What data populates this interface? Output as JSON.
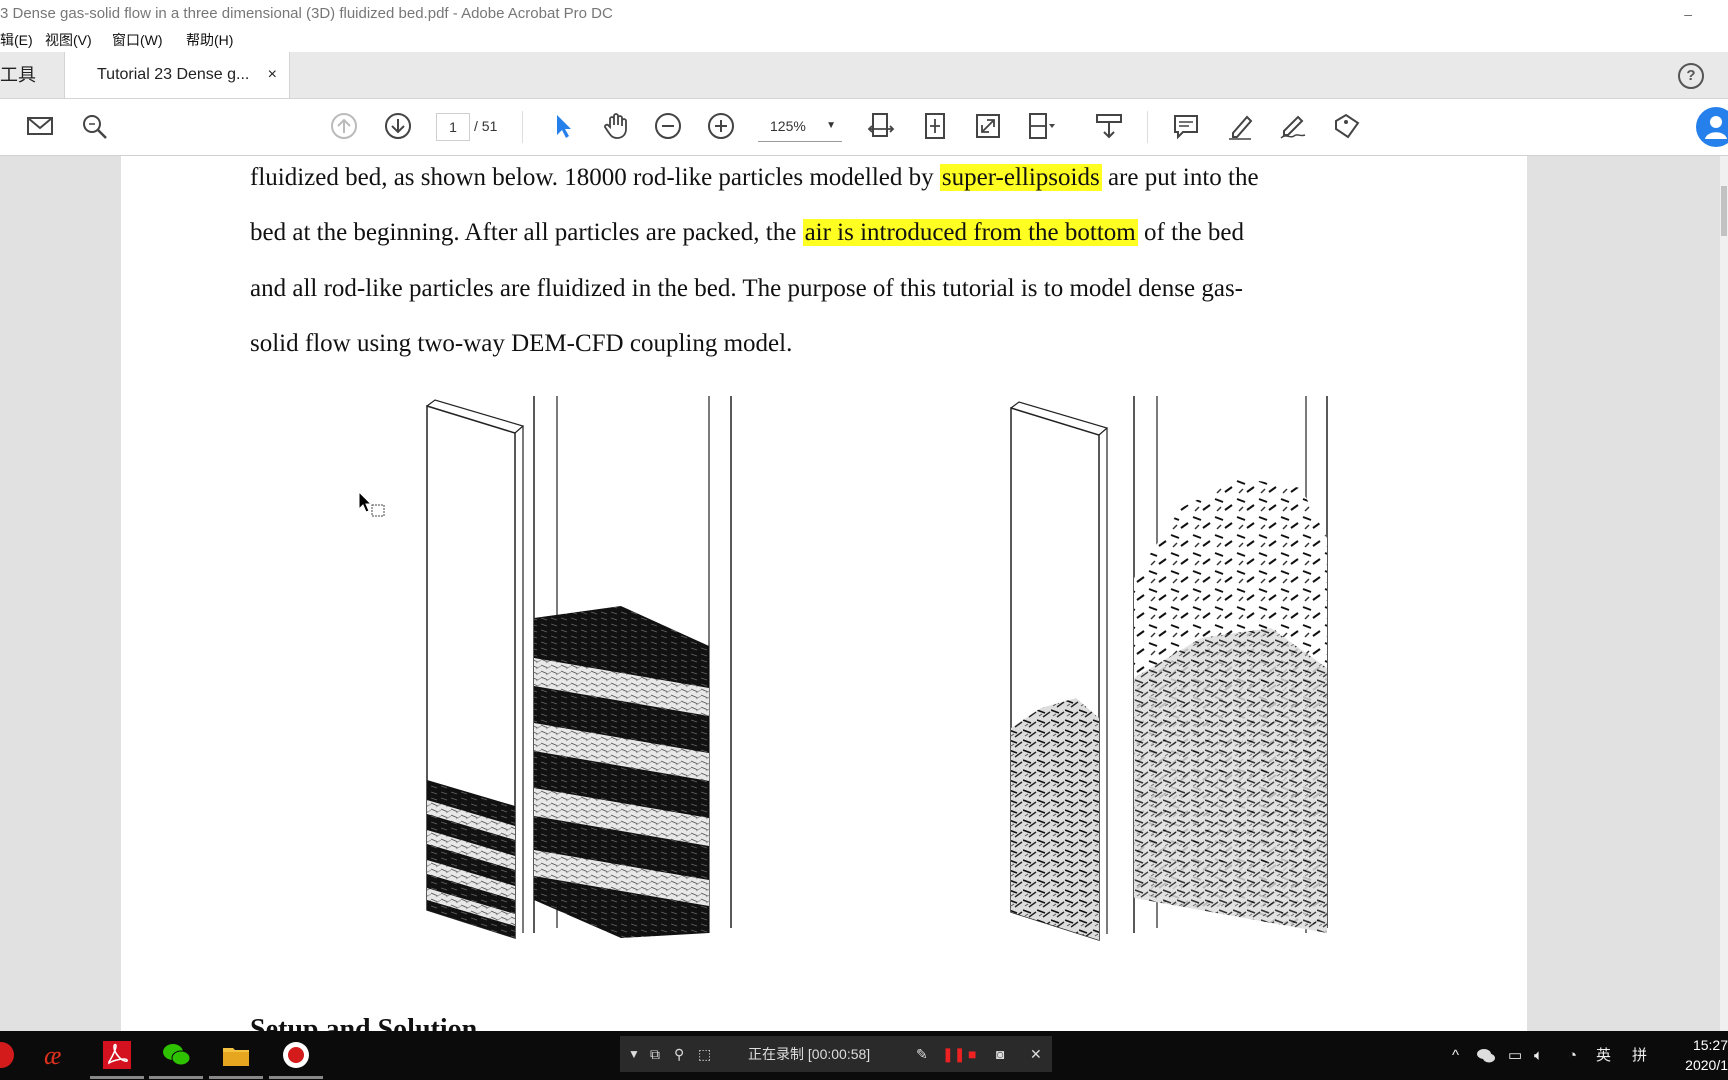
{
  "window": {
    "title": "3 Dense gas-solid flow in a three dimensional (3D) fluidized bed.pdf - Adobe Acrobat Pro DC",
    "minimize_glyph": "–"
  },
  "menu": [
    "辑(E)",
    "视图(V)",
    "窗口(W)",
    "帮助(H)"
  ],
  "tabs": {
    "tools_label": "工具",
    "doc_tab_label": "Tutorial 23 Dense g...",
    "close_glyph": "×",
    "help_glyph": "?"
  },
  "toolbar": {
    "page_current": "1",
    "page_total": "/ 51",
    "zoom": "125%",
    "zoom_caret": "▼",
    "icons": [
      "mail-icon",
      "search-icon",
      "prev-page-icon",
      "next-page-icon",
      "select-cursor-icon",
      "hand-icon",
      "zoom-out-icon",
      "zoom-in-icon",
      "fit-width-icon",
      "fit-page-icon",
      "fullscreen-icon",
      "page-display-icon",
      "scroll-icon",
      "comment-icon",
      "highlight-icon",
      "sign-icon",
      "stamp-icon"
    ]
  },
  "document": {
    "paragraph": [
      {
        "pre": "fluidized bed, as shown below. 18000 rod-like particles modelled by ",
        "hl": "super-ellipsoids",
        "post": " are put into the"
      },
      {
        "pre": "bed at the beginning. After all particles are packed, the ",
        "hl": "air is introduced from the bottom",
        "post": " of the bed"
      },
      {
        "pre": "and all rod-like particles are fluidized in the bed. The purpose of this tutorial is to model dense gas-",
        "hl": "",
        "post": ""
      },
      {
        "pre": "solid flow using two-way DEM-CFD coupling model.",
        "hl": "",
        "post": ""
      }
    ],
    "next_heading": "Setup and Solution",
    "highlight_color": "#ffff22"
  },
  "taskbar": {
    "apps": [
      "screen-recorder-icon",
      "adobe-ae-icon",
      "acrobat-icon",
      "wechat-icon",
      "file-explorer-icon",
      "record-icon"
    ],
    "recorder": {
      "status": "正在录制 [00:00:58]"
    },
    "tray": {
      "ime_lang": "英",
      "ime_mode": "拼",
      "caret": "^"
    },
    "clock": {
      "time": "15:27",
      "date": "2020/1"
    }
  }
}
